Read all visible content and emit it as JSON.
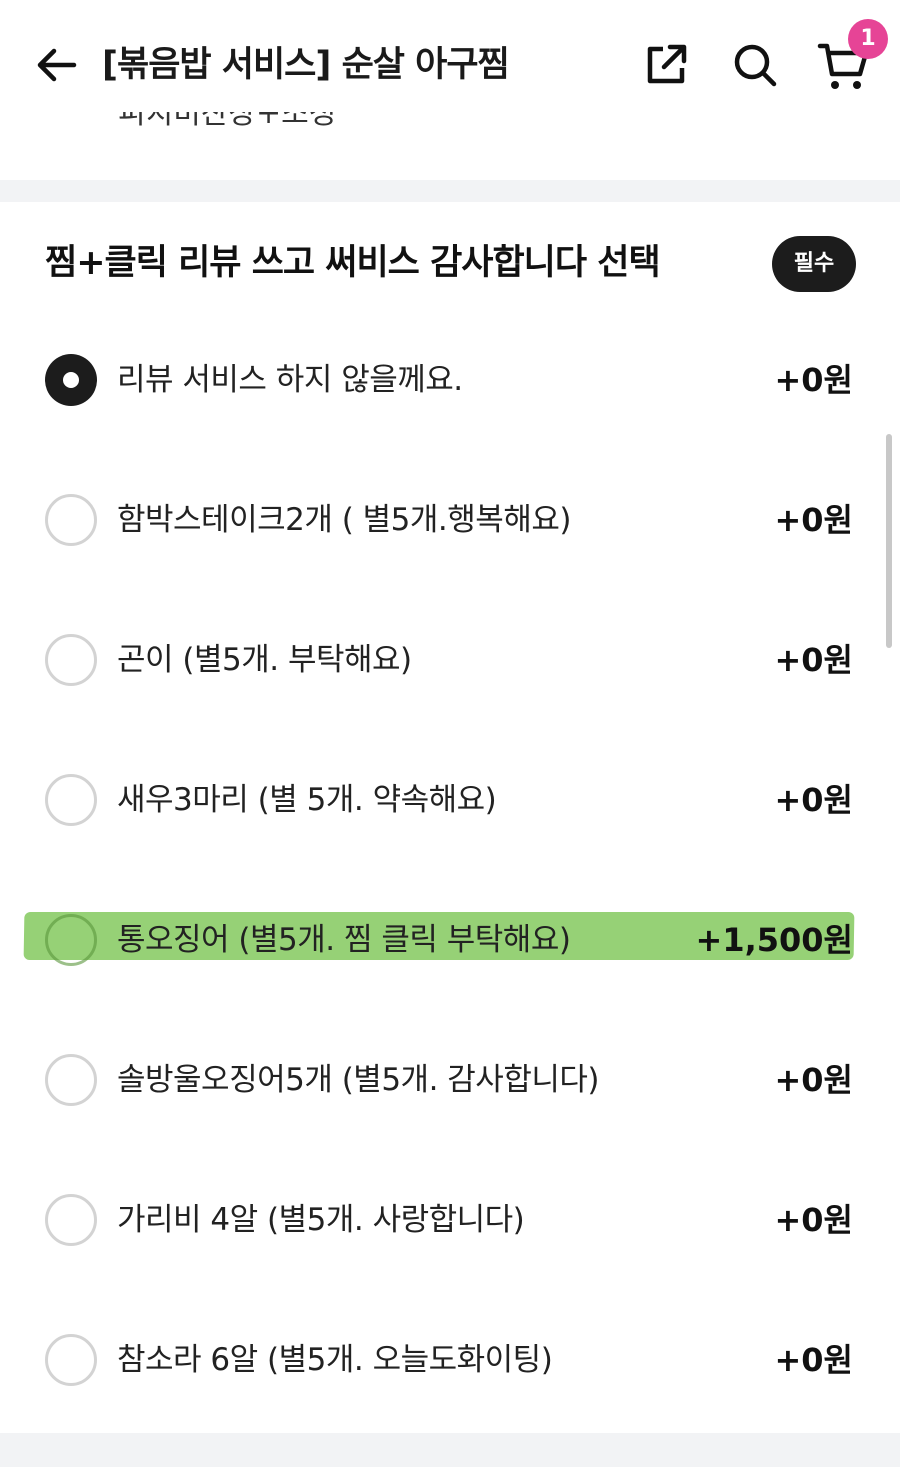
{
  "header": {
    "title": "[볶음밥 서비스] 순살 아구찜",
    "cart_count": "1"
  },
  "prev_option_label": "피치비찬장+조청",
  "section": {
    "title": "찜+클릭 리뷰 쓰고 써비스 감사합니다 선택",
    "required_label": "필수"
  },
  "options": [
    {
      "label": "리뷰 서비스 하지 않을께요.",
      "price": "+0원",
      "selected": true
    },
    {
      "label": "함박스테이크2개 ( 별5개.행복해요)",
      "price": "+0원",
      "selected": false
    },
    {
      "label": "곤이 (별5개. 부탁해요)",
      "price": "+0원",
      "selected": false
    },
    {
      "label": "새우3마리 (별 5개. 약속해요)",
      "price": "+0원",
      "selected": false
    },
    {
      "label": "통오징어 (별5개. 찜 클릭 부탁해요)",
      "price": "+1,500원",
      "selected": false,
      "highlighted": true
    },
    {
      "label": "솔방울오징어5개 (별5개. 감사합니다)",
      "price": "+0원",
      "selected": false
    },
    {
      "label": "가리비 4알 (별5개. 사랑합니다)",
      "price": "+0원",
      "selected": false
    },
    {
      "label": "참소라 6알 (별5개. 오늘도화이팅)",
      "price": "+0원",
      "selected": false
    }
  ],
  "colors": {
    "badge": "#e64496",
    "highlight": "#78c450",
    "selected_radio": "#1c1c1c"
  }
}
